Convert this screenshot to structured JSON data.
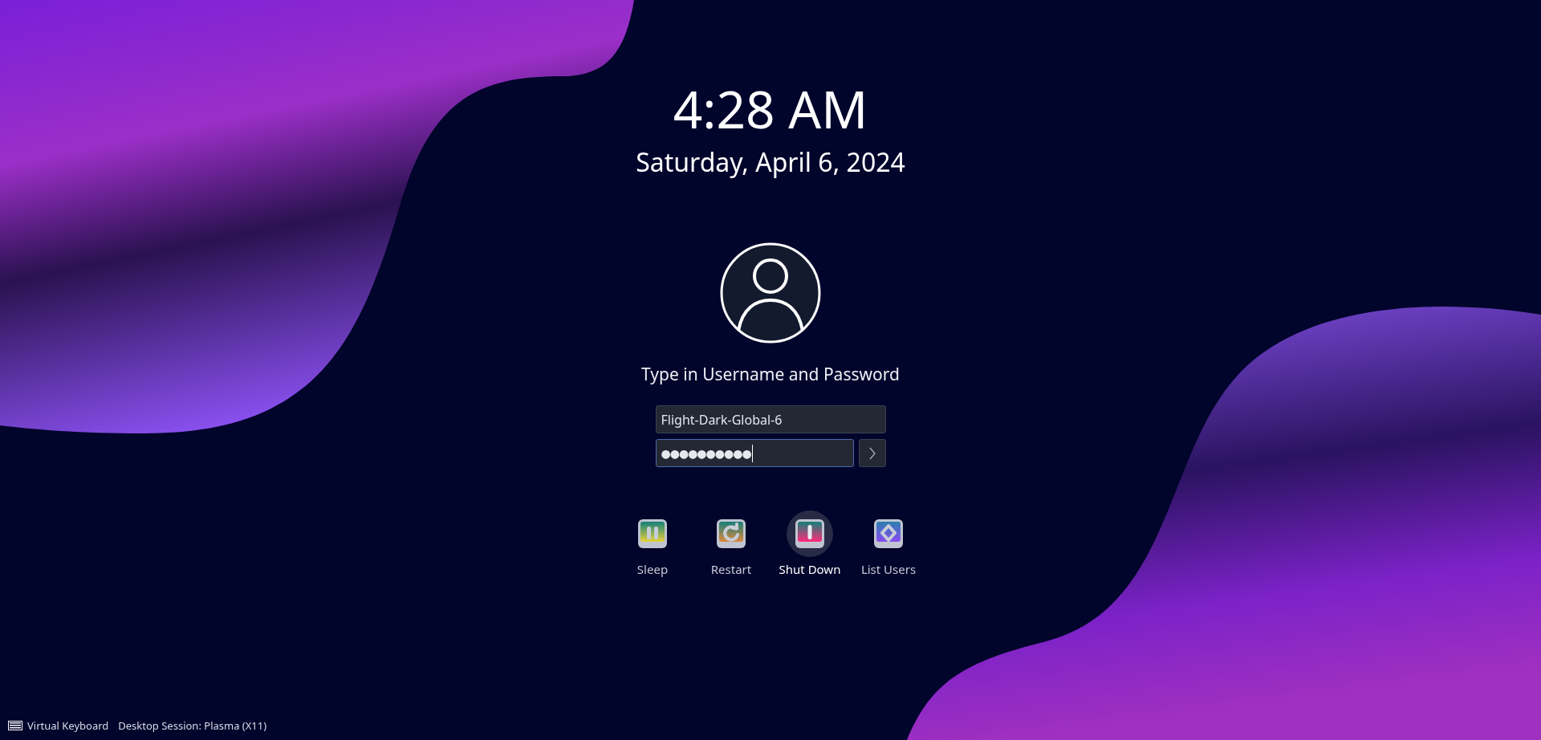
{
  "clock": {
    "time": "4:28 AM",
    "date": "Saturday, April 6, 2024"
  },
  "login": {
    "prompt": "Type in Username and Password",
    "username": "Flight-Dark-Global-6",
    "password": "●●●●●●●●●●",
    "password_focused": true
  },
  "actions": [
    {
      "kind": "sleep",
      "label": "Sleep",
      "selected": false
    },
    {
      "kind": "restart",
      "label": "Restart",
      "selected": false
    },
    {
      "kind": "shutdown",
      "label": "Shut Down",
      "selected": true
    },
    {
      "kind": "users",
      "label": "List Users",
      "selected": false
    }
  ],
  "footer": {
    "keyboard": "Virtual Keyboard",
    "session": "Desktop Session: Plasma (X11)"
  }
}
